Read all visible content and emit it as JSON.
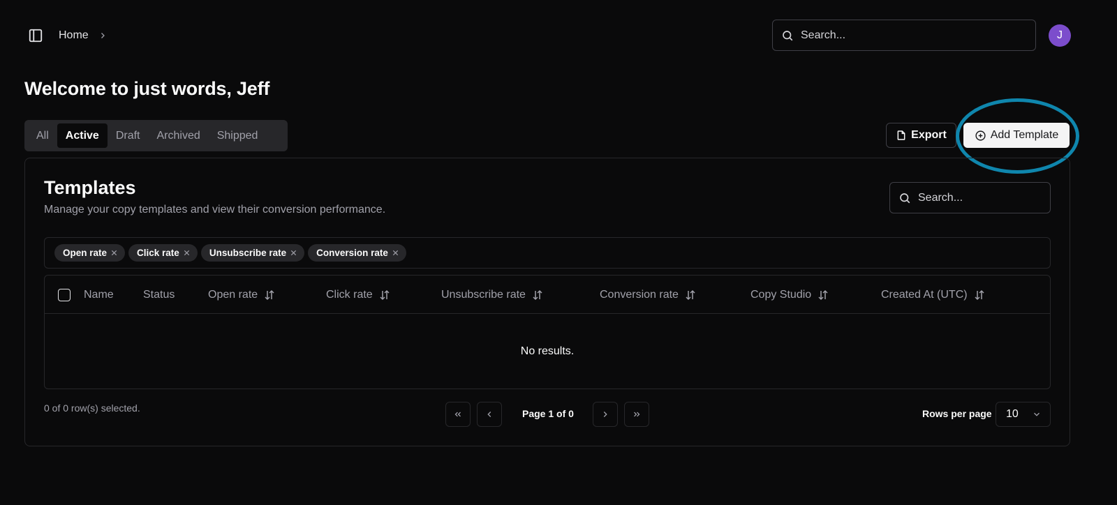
{
  "header": {
    "breadcrumb": [
      "Home"
    ],
    "search_placeholder": "Search...",
    "avatar_initial": "J"
  },
  "page_title": "Welcome to just words, Jeff",
  "tabs": [
    {
      "label": "All",
      "active": false
    },
    {
      "label": "Active",
      "active": true
    },
    {
      "label": "Draft",
      "active": false
    },
    {
      "label": "Archived",
      "active": false
    },
    {
      "label": "Shipped",
      "active": false
    }
  ],
  "actions": {
    "export_label": "Export",
    "add_label": "Add Template"
  },
  "card": {
    "title": "Templates",
    "description": "Manage your copy templates and view their conversion performance.",
    "search_placeholder": "Search..."
  },
  "filters": [
    "Open rate",
    "Click rate",
    "Unsubscribe rate",
    "Conversion rate"
  ],
  "table": {
    "columns": [
      {
        "label": "Name",
        "sortable": false
      },
      {
        "label": "Status",
        "sortable": false
      },
      {
        "label": "Open rate",
        "sortable": true
      },
      {
        "label": "Click rate",
        "sortable": true
      },
      {
        "label": "Unsubscribe rate",
        "sortable": true
      },
      {
        "label": "Conversion rate",
        "sortable": true
      },
      {
        "label": "Copy Studio",
        "sortable": true
      },
      {
        "label": "Created At (UTC)",
        "sortable": true
      }
    ],
    "empty_text": "No results."
  },
  "footer": {
    "selection_text": "0 of 0 row(s) selected.",
    "page_text": "Page 1 of 0",
    "rows_per_page_label": "Rows per page",
    "rows_per_page_value": "10"
  },
  "colors": {
    "background": "#0a0a0b",
    "avatar": "#7c4dcc",
    "highlight_ring": "#0f86ad",
    "primary_button": "#f4f4f5"
  }
}
